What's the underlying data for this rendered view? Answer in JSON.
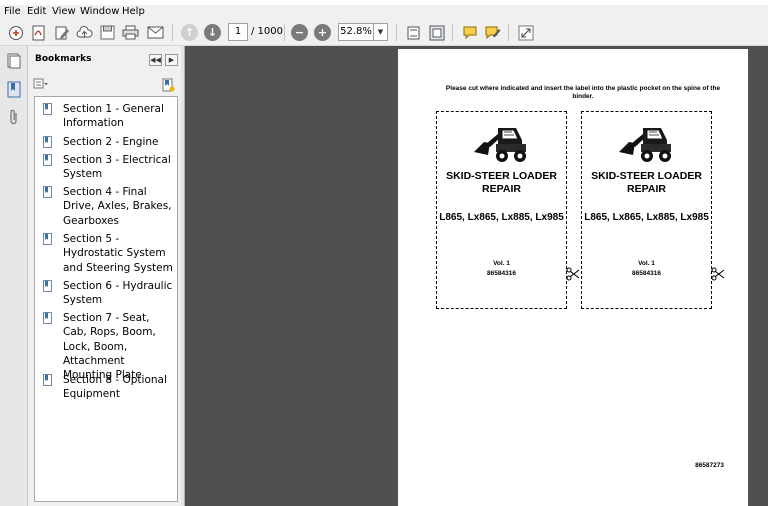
{
  "menu": {
    "file": "File",
    "edit": "Edit",
    "view": "View",
    "window": "Window",
    "help": "Help"
  },
  "toolbar": {
    "page_current": "1",
    "page_total": "/ 1000",
    "zoom": "52.8%",
    "icons": [
      "create-icon",
      "open-pdf-icon",
      "edit-icon",
      "cloud-icon",
      "save-icon",
      "print-icon",
      "email-icon",
      "previous-page-icon",
      "next-page-icon",
      "zoom-out-icon",
      "zoom-in-icon",
      "fit-page-icon",
      "page-view-icon",
      "comment-icon",
      "sign-icon",
      "expand-icon"
    ]
  },
  "bookmarks": {
    "title": "Bookmarks",
    "items": [
      {
        "label": "Section 1 - General Information"
      },
      {
        "label": "Section 2 - Engine"
      },
      {
        "label": "Section 3 - Electrical System"
      },
      {
        "label": "Section 4 - Final Drive, Axles, Brakes, Gearboxes"
      },
      {
        "label": "Section 5 - Hydrostatic System and Steering System"
      },
      {
        "label": "Section 6 - Hydraulic System"
      },
      {
        "label": "Section 7 - Seat, Cab, Rops, Boom, Lock, Boom, Attachment Mounting Plate"
      },
      {
        "label": "Section 8 - Optional Equipment"
      }
    ]
  },
  "document": {
    "instruction": "Please cut where indicated and insert the label into the plastic pocket on the spine of the binder.",
    "labels": [
      {
        "title": "SKID-STEER LOADER REPAIR",
        "models": "L865, Lx865, Lx885, Lx985",
        "vol": "Vol. 1",
        "part_number": "86584316"
      },
      {
        "title": "SKID-STEER LOADER REPAIR",
        "models": "L865, Lx865, Lx885, Lx985",
        "vol": "Vol. 1",
        "part_number": "86584316"
      }
    ],
    "page_code": "86587273"
  },
  "colors": {
    "doc_background": "#505050",
    "panel": "#f0f0f0"
  }
}
